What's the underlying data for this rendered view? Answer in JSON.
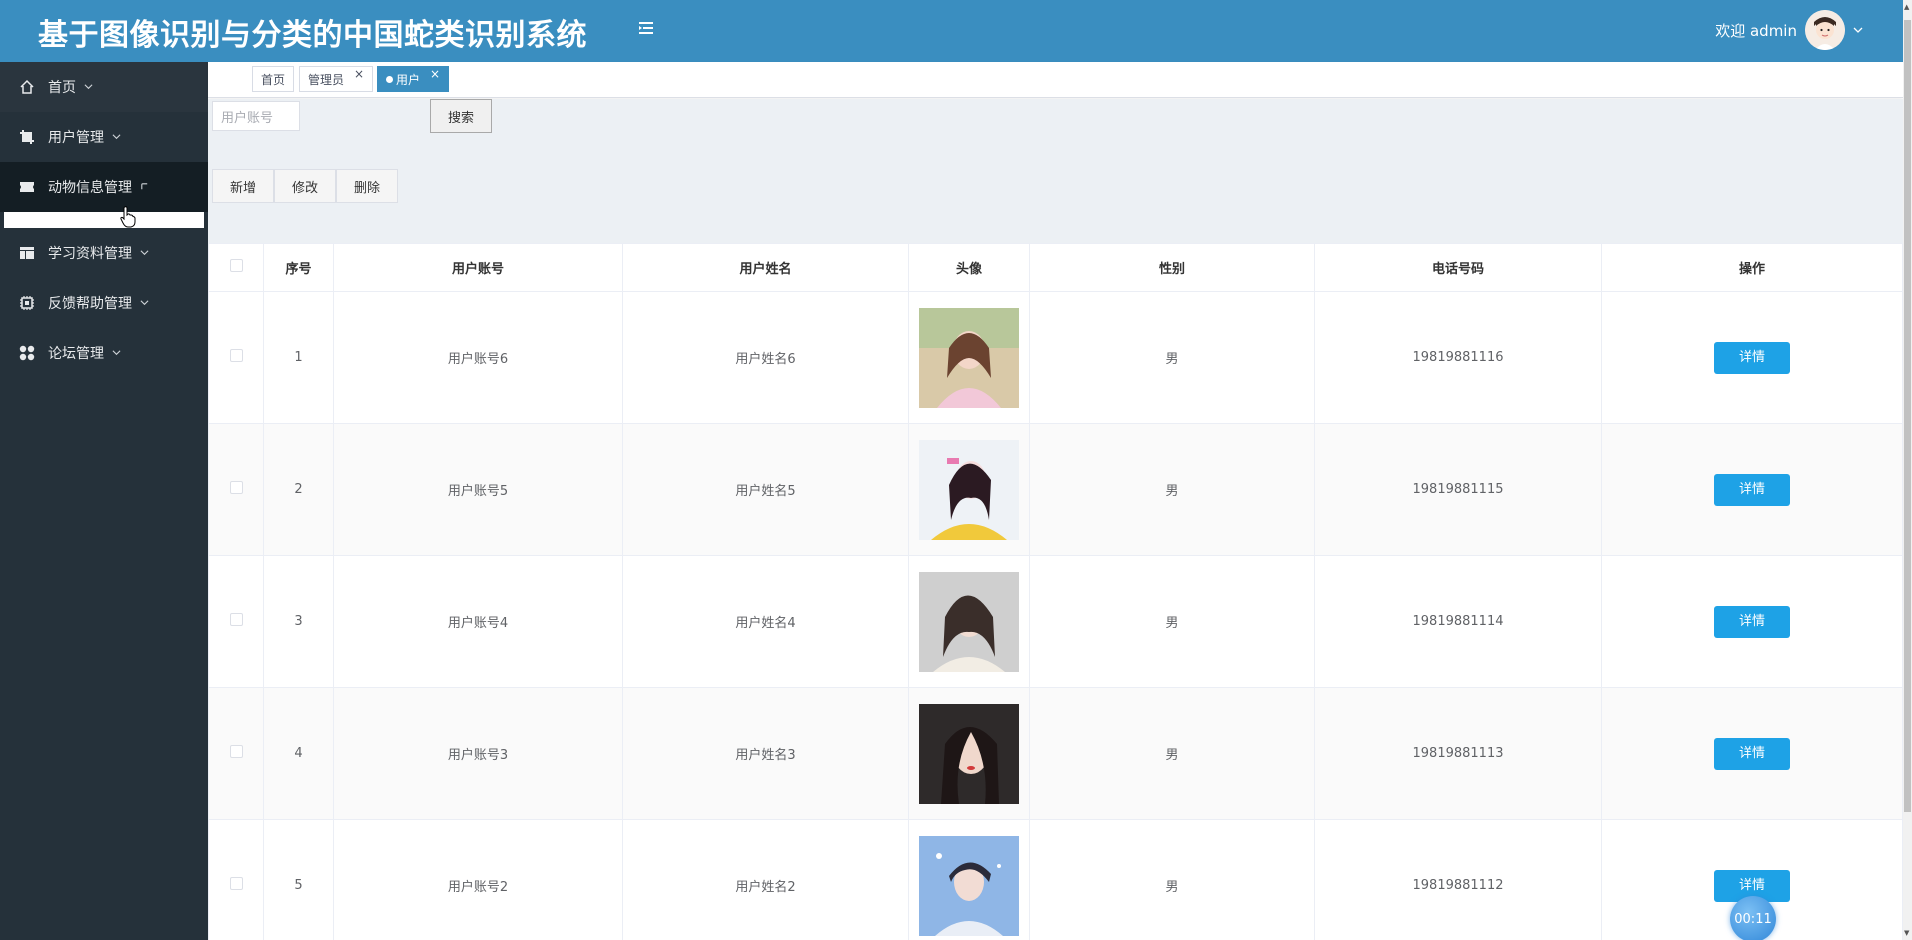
{
  "header": {
    "title": "基于图像识别与分类的中国蛇类识别系统",
    "welcome": "欢迎 admin",
    "bg_color": "#3a8ec0"
  },
  "sidebar": {
    "items": [
      {
        "label": "首页",
        "icon": "home-icon"
      },
      {
        "label": "用户管理",
        "icon": "crop-icon"
      },
      {
        "label": "动物信息管理",
        "icon": "ticket-icon"
      },
      {
        "label": "学习资料管理",
        "icon": "layout-icon"
      },
      {
        "label": "反馈帮助管理",
        "icon": "chip-icon"
      },
      {
        "label": "论坛管理",
        "icon": "apps-icon"
      }
    ]
  },
  "tabs": [
    {
      "label": "首页",
      "closable": false
    },
    {
      "label": "管理员",
      "closable": true
    },
    {
      "label": "用户",
      "closable": true,
      "active": true
    }
  ],
  "search": {
    "placeholder": "用户账号",
    "button": "搜索"
  },
  "actions": {
    "add": "新增",
    "edit": "修改",
    "delete": "删除"
  },
  "table": {
    "headers": [
      "序号",
      "用户账号",
      "用户姓名",
      "头像",
      "性别",
      "电话号码",
      "操作"
    ],
    "rows": [
      {
        "index": "1",
        "account": "用户账号6",
        "name": "用户姓名6",
        "gender": "男",
        "phone": "19819881116",
        "action": "详情"
      },
      {
        "index": "2",
        "account": "用户账号5",
        "name": "用户姓名5",
        "gender": "男",
        "phone": "19819881115",
        "action": "详情"
      },
      {
        "index": "3",
        "account": "用户账号4",
        "name": "用户姓名4",
        "gender": "男",
        "phone": "19819881114",
        "action": "详情"
      },
      {
        "index": "4",
        "account": "用户账号3",
        "name": "用户姓名3",
        "gender": "男",
        "phone": "19819881113",
        "action": "详情"
      },
      {
        "index": "5",
        "account": "用户账号2",
        "name": "用户姓名2",
        "gender": "男",
        "phone": "19819881112",
        "action": "详情"
      }
    ]
  },
  "timer": "00:11",
  "colors": {
    "accent": "#3a8ec0",
    "sidebar_bg": "#25313a",
    "detail_button": "#1ea2e6"
  }
}
